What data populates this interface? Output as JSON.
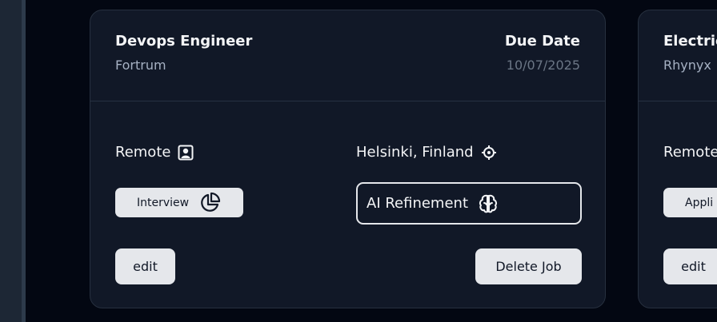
{
  "cards": [
    {
      "title": "Devops Engineer",
      "company": "Fortrum",
      "due_label": "Due Date",
      "due_value": "10/07/2025",
      "work_mode": "Remote",
      "work_mode_icon": "user-badge-icon",
      "location": "Helsinki, Finland",
      "location_icon": "locate-icon",
      "status": "Interview",
      "status_icon": "pie-chart-icon",
      "refine_label": "AI Refinement",
      "refine_icon": "brain-icon",
      "edit_label": "edit",
      "delete_label": "Delete Job"
    },
    {
      "title": "Electric",
      "company": "Rhynyx",
      "work_mode": "Remote",
      "status": "Appli",
      "edit_label": "edit"
    }
  ],
  "colors": {
    "page_bg": "#030712",
    "card_bg": "#111827",
    "pill_bg": "#e5e7eb",
    "muted_text": "#a6b1c3"
  }
}
